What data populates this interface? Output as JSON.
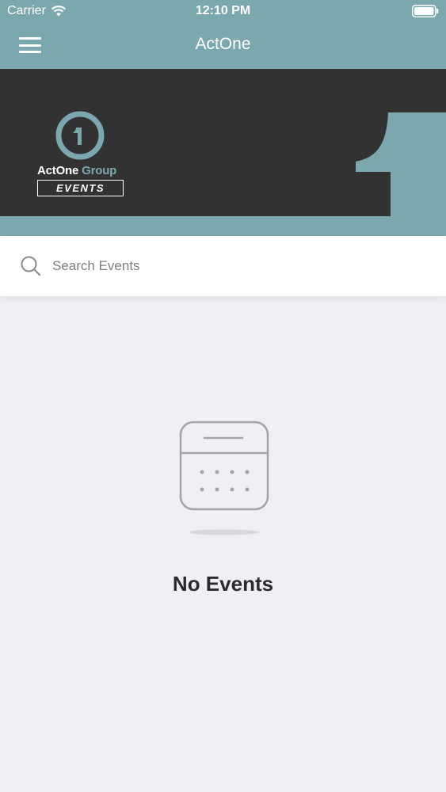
{
  "status_bar": {
    "carrier": "Carrier",
    "time": "12:10 PM"
  },
  "nav": {
    "title": "ActOne",
    "menu_icon": "hamburger-menu-icon"
  },
  "banner": {
    "logo_name_main": "ActOne",
    "logo_name_group": "Group",
    "logo_events": "EVENTS",
    "logo_digit": "1"
  },
  "search": {
    "placeholder": "Search Events",
    "value": ""
  },
  "empty_state": {
    "icon": "calendar-icon",
    "text": "No Events"
  },
  "colors": {
    "accent": "#7ba8ae",
    "banner_dark": "#333233",
    "background": "#efeff4"
  }
}
